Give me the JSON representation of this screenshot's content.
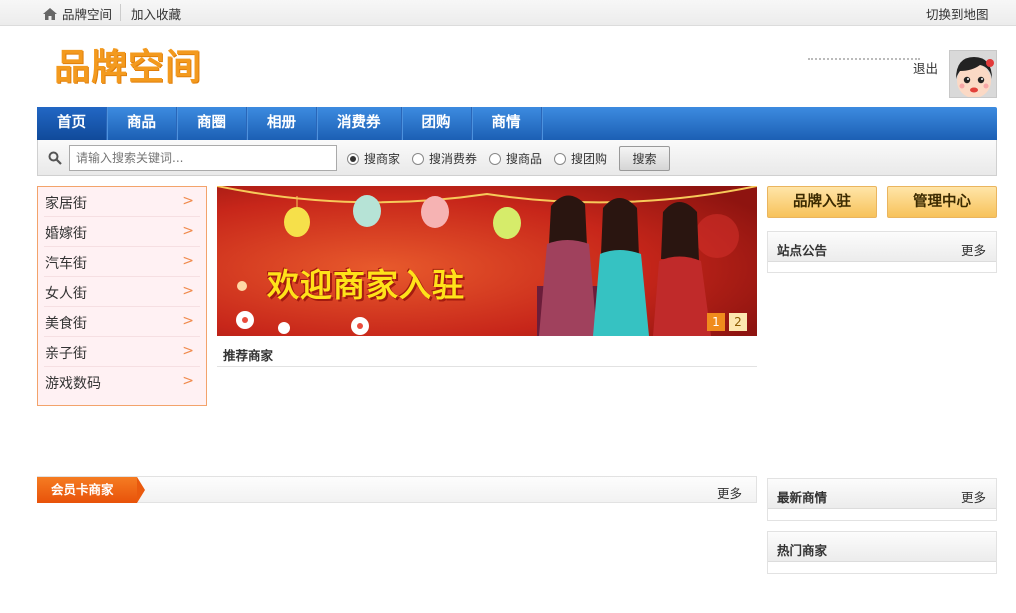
{
  "topbar": {
    "home_label": "品牌空间",
    "favorite_label": "加入收藏",
    "switch_map_label": "切换到地图"
  },
  "header": {
    "logo_text": "品牌空间",
    "logout_label": "退出"
  },
  "nav": {
    "items": [
      {
        "label": "首页",
        "active": true
      },
      {
        "label": "商品"
      },
      {
        "label": "商圈"
      },
      {
        "label": "相册"
      },
      {
        "label": "消费券"
      },
      {
        "label": "团购"
      },
      {
        "label": "商情"
      }
    ]
  },
  "search": {
    "placeholder": "请输入搜索关键词...",
    "options": [
      {
        "label": "搜商家",
        "checked": true
      },
      {
        "label": "搜消费券"
      },
      {
        "label": "搜商品"
      },
      {
        "label": "搜团购"
      }
    ],
    "button_label": "搜索"
  },
  "categories": {
    "items": [
      {
        "label": "家居街"
      },
      {
        "label": "婚嫁街"
      },
      {
        "label": "汽车街"
      },
      {
        "label": "女人街"
      },
      {
        "label": "美食街"
      },
      {
        "label": "亲子街"
      },
      {
        "label": "游戏数码"
      }
    ],
    "chevron": ">"
  },
  "banner": {
    "text": "欢迎商家入驻",
    "pages": [
      "1",
      "2"
    ]
  },
  "recommended": {
    "title": "推荐商家"
  },
  "actions": {
    "brand_join_label": "品牌入驻",
    "admin_center_label": "管理中心"
  },
  "panels": {
    "notice": {
      "title": "站点公告",
      "more": "更多"
    },
    "latest_news": {
      "title": "最新商情",
      "more": "更多"
    },
    "hot_merchants": {
      "title": "热门商家"
    }
  },
  "member": {
    "title": "会员卡商家",
    "more": "更多"
  },
  "colors": {
    "nav_blue": "#1c5fb4",
    "brand_orange": "#f39a1e",
    "accent_orange": "#e8520a",
    "banner_red": "#c7261a"
  }
}
